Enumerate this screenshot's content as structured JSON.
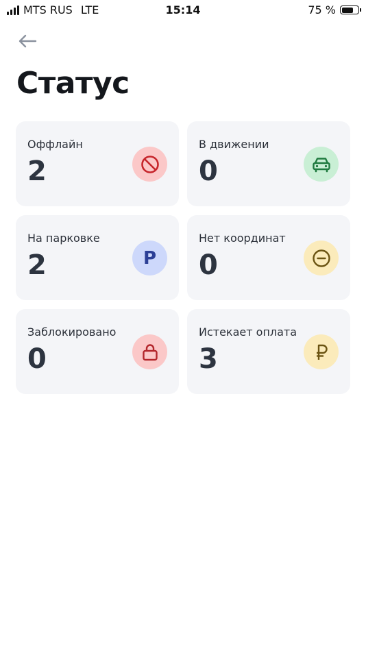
{
  "status_bar": {
    "carrier": "MTS RUS",
    "network": "LTE",
    "time": "15:14",
    "battery_percent": "75 %",
    "battery_level": 0.75
  },
  "header": {
    "back_icon": "arrow-left-icon",
    "title": "Статус"
  },
  "colors": {
    "card_background": "#f4f5f8",
    "red_bg": "#fbc8c8",
    "red_fg": "#c6252b",
    "green_bg": "#c9efd5",
    "green_fg": "#1f7a3f",
    "blue_bg": "#cdd8fb",
    "blue_fg": "#2c3f96",
    "yellow_bg": "#fbebbb",
    "yellow_fg": "#6b5413"
  },
  "cards": [
    {
      "label": "Оффлайн",
      "value": "2",
      "icon": "forbidden-icon"
    },
    {
      "label": "В движении",
      "value": "0",
      "icon": "car-icon"
    },
    {
      "label": "На парковке",
      "value": "2",
      "icon": "parking-icon",
      "icon_text": "P"
    },
    {
      "label": "Нет координат",
      "value": "0",
      "icon": "minus-circle-icon"
    },
    {
      "label": "Заблокировано",
      "value": "0",
      "icon": "lock-icon"
    },
    {
      "label": "Истекает оплата",
      "value": "3",
      "icon": "ruble-icon"
    }
  ]
}
